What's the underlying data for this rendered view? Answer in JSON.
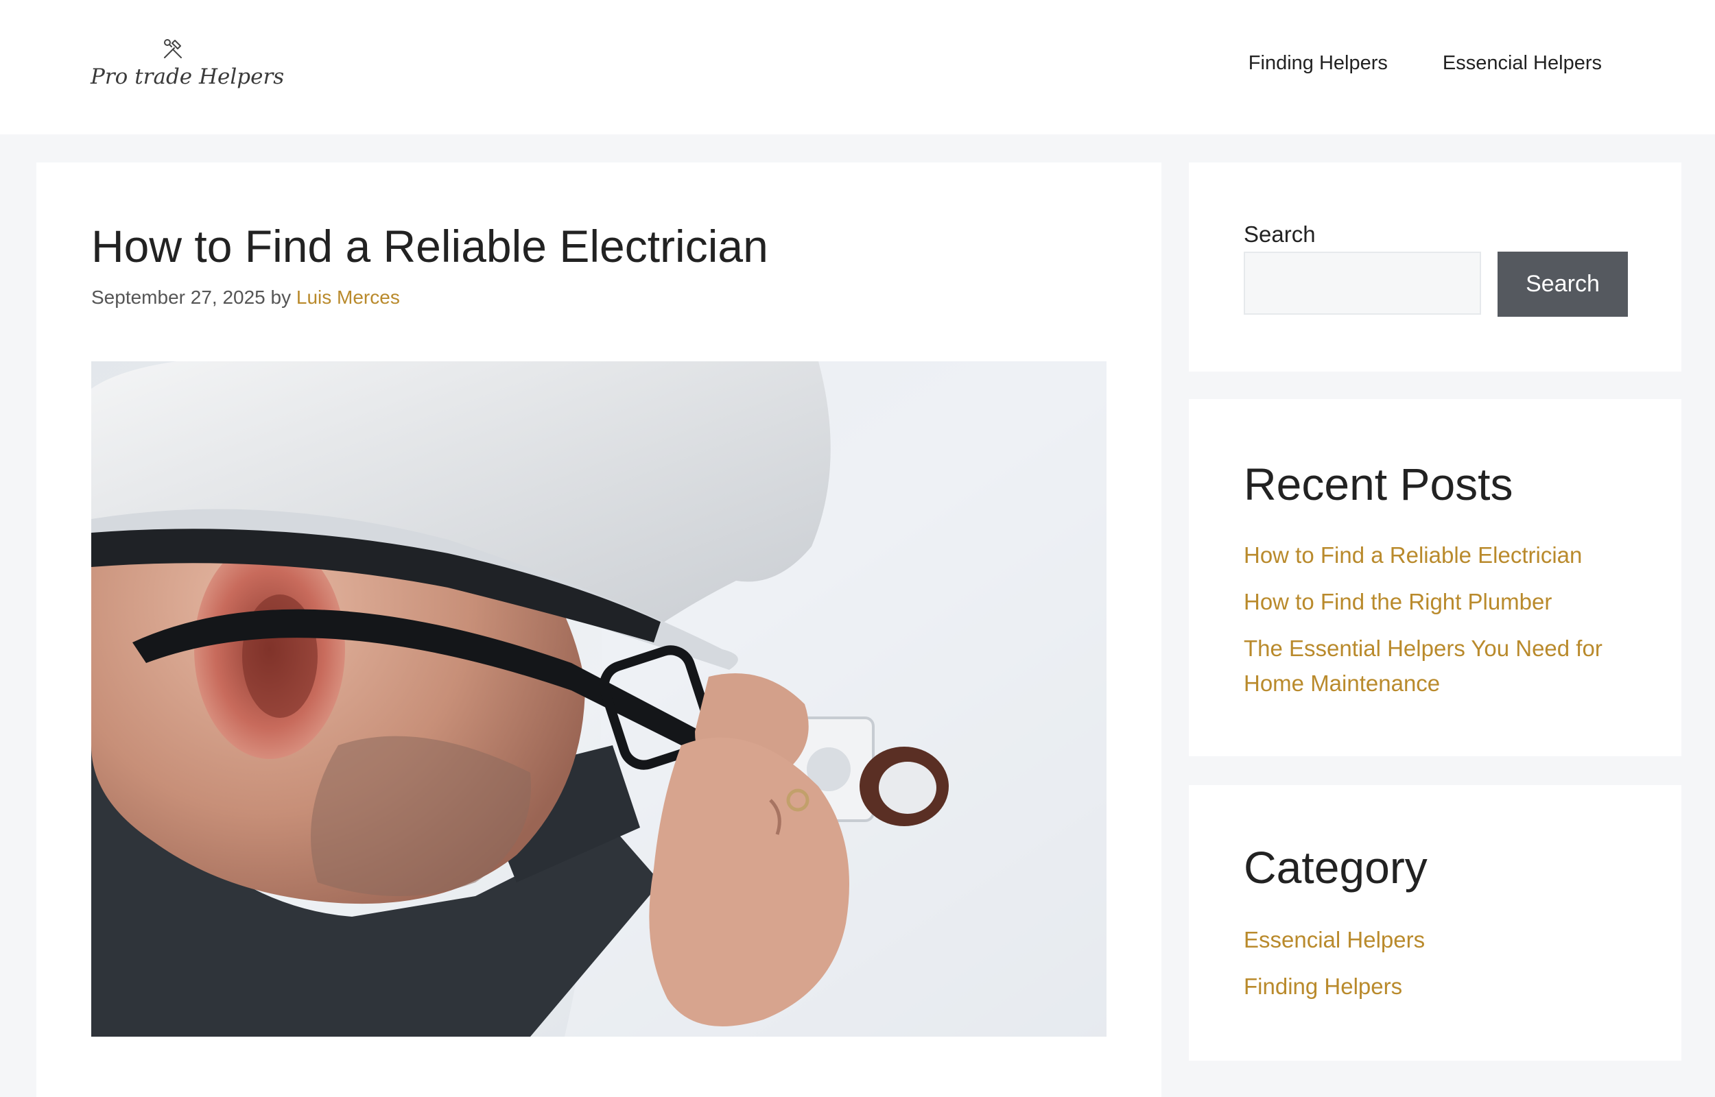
{
  "header": {
    "brand_name": "Pro trade Helpers",
    "brand_icon": "hammer-wrench-icon",
    "nav": [
      {
        "label": "Finding Helpers"
      },
      {
        "label": "Essencial Helpers"
      }
    ]
  },
  "article": {
    "title": "How to Find a Reliable Electrician",
    "date": "September 27, 2025",
    "by": "by",
    "author": "Luis Merces",
    "image_subject": "electrician-photo"
  },
  "sidebar": {
    "search": {
      "label": "Search",
      "placeholder": "",
      "button_label": "Search"
    },
    "recent_posts": {
      "title": "Recent Posts",
      "items": [
        {
          "label": "How to Find a Reliable Electrician"
        },
        {
          "label": "How to Find the Right Plumber"
        },
        {
          "label": "The Essential Helpers You Need for Home Maintenance"
        }
      ]
    },
    "category": {
      "title": "Category",
      "items": [
        {
          "label": "Essencial Helpers"
        },
        {
          "label": "Finding Helpers"
        }
      ]
    }
  },
  "colors": {
    "accent_link": "#b98a2c",
    "button_bg": "#55595f",
    "page_bg": "#f5f6f8"
  }
}
